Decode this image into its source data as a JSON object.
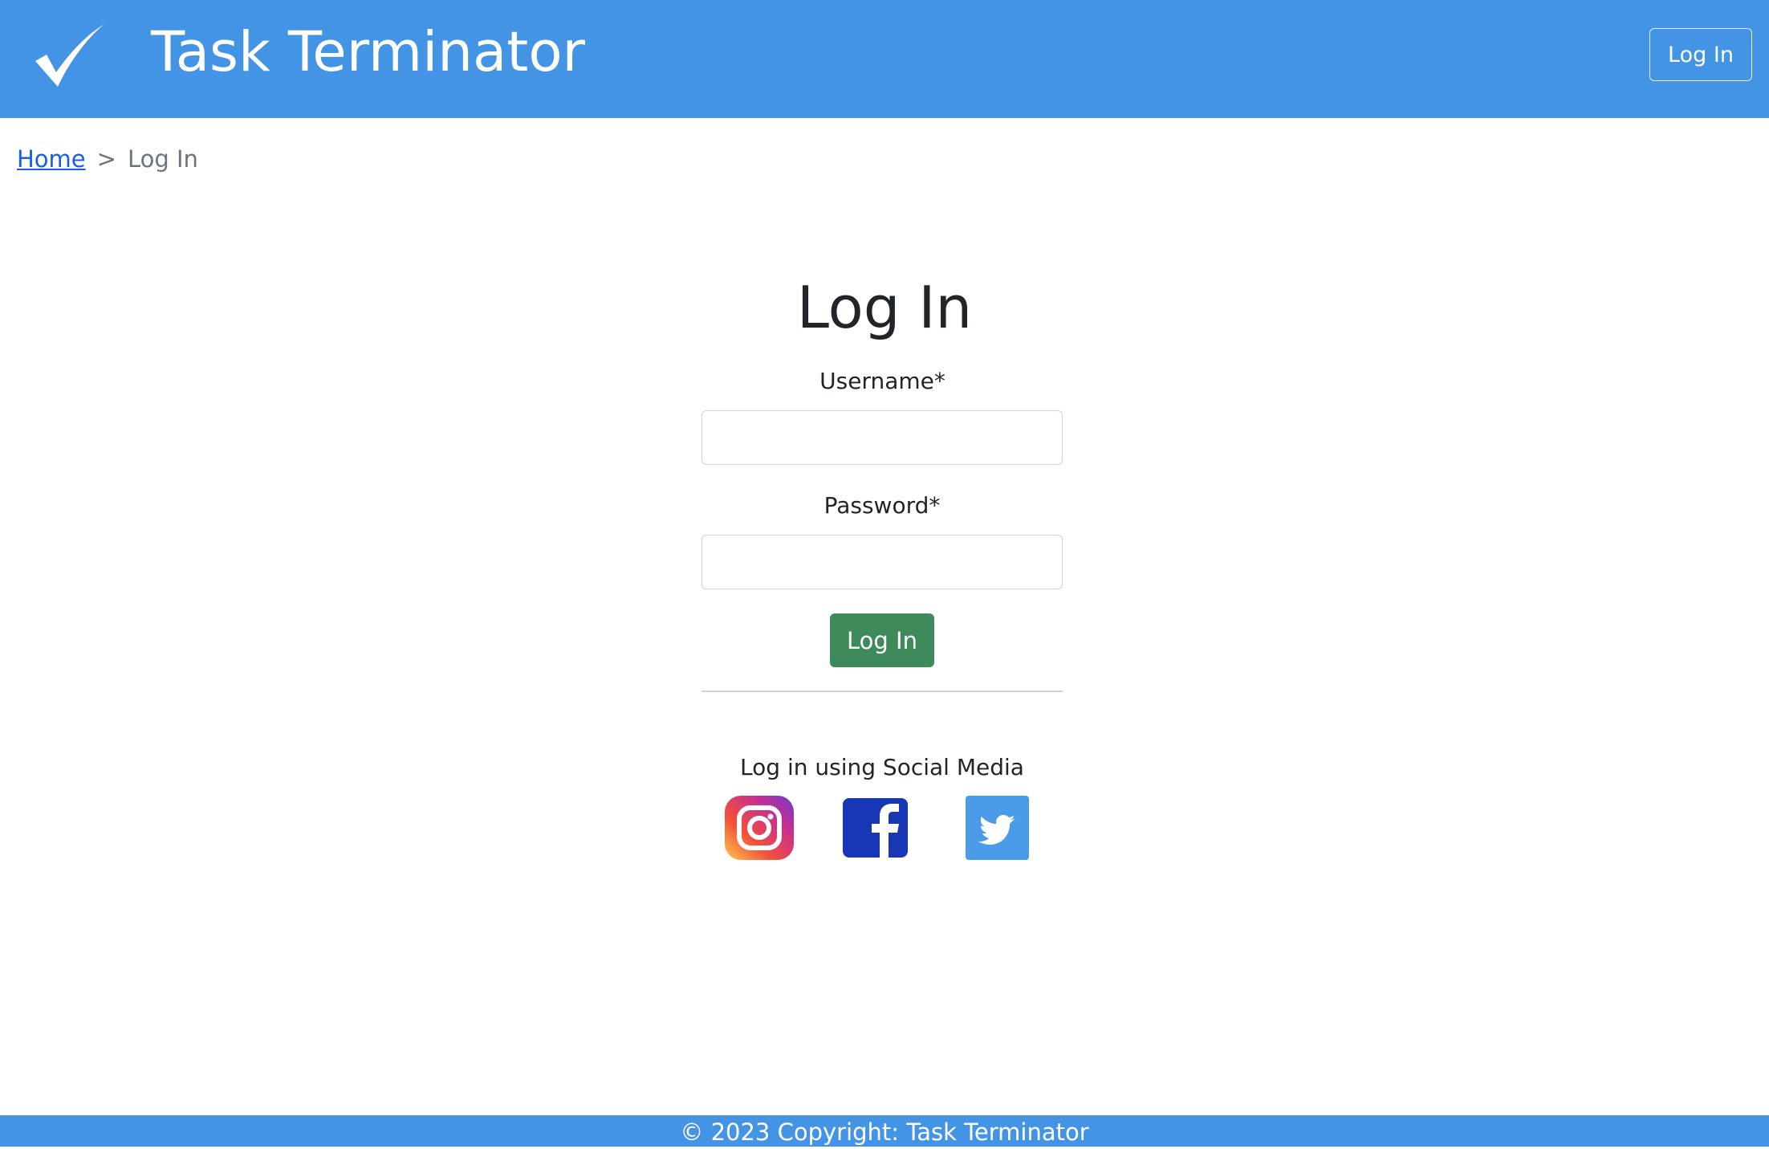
{
  "header": {
    "brand": "Task Terminator",
    "login_button": "Log In",
    "logo_icon": "checkmark-icon",
    "bg_color": "#4494e5"
  },
  "breadcrumb": {
    "home": "Home",
    "separator": ">",
    "current": "Log In"
  },
  "form": {
    "title": "Log In",
    "username_label": "Username*",
    "username_value": "",
    "password_label": "Password*",
    "password_value": "",
    "submit_label": "Log In",
    "submit_color": "#3f8a5b"
  },
  "social": {
    "title": "Log in using Social Media",
    "icons": [
      "instagram-icon",
      "facebook-icon",
      "twitter-icon"
    ]
  },
  "footer": {
    "text": "© 2023 Copyright: Task Terminator"
  }
}
